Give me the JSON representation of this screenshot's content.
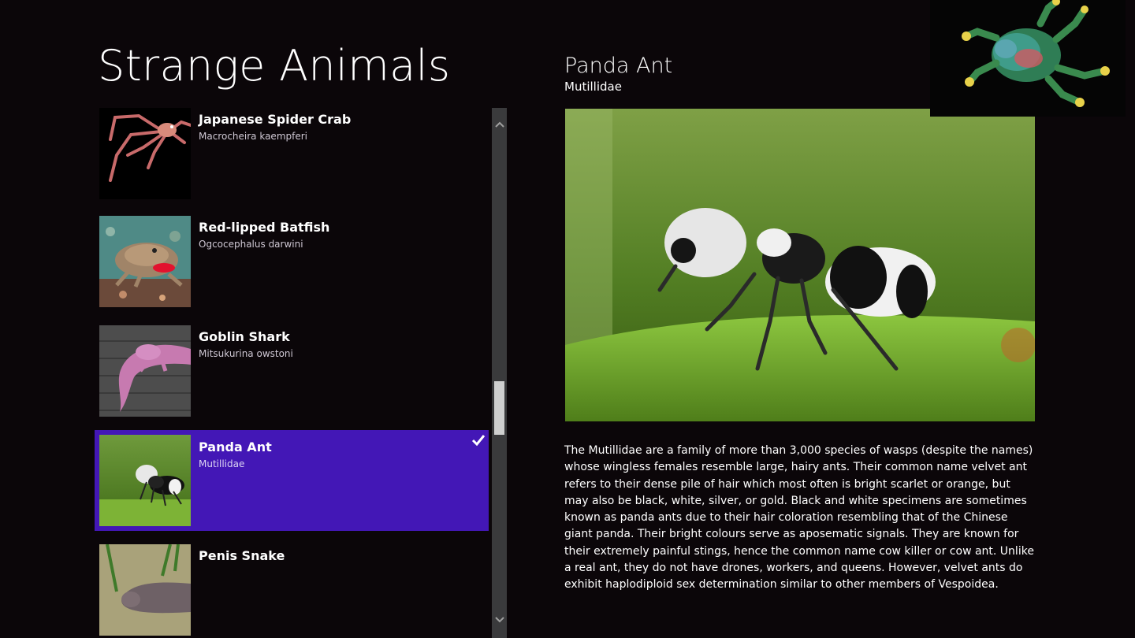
{
  "app": {
    "title": "Strange Animals"
  },
  "list": {
    "items": [
      {
        "name": "Japanese Spider Crab",
        "scientific": "Macrocheira kaempferi",
        "thumb_icon": "spider-crab-photo"
      },
      {
        "name": "Red-lipped Batfish",
        "scientific": "Ogcocephalus darwini",
        "thumb_icon": "batfish-photo"
      },
      {
        "name": "Goblin Shark",
        "scientific": "Mitsukurina owstoni",
        "thumb_icon": "goblin-shark-photo"
      },
      {
        "name": "Panda Ant",
        "scientific": "Mutillidae",
        "thumb_icon": "panda-ant-photo",
        "selected": true
      },
      {
        "name": "Penis Snake",
        "scientific": "",
        "thumb_icon": "penis-snake-photo"
      }
    ],
    "scroll_fraction": 0.52
  },
  "detail": {
    "title": "Panda Ant",
    "subtitle": "Mutillidae",
    "image_icon": "panda-ant-photo",
    "description": "The Mutillidae are a family of more than 3,000 species of wasps (despite the names) whose wingless females resemble large, hairy ants. Their common name velvet ant refers to their dense pile of hair which most often is bright scarlet or orange, but may also be black, white, silver, or gold. Black and white specimens are sometimes known as panda ants due to their hair coloration resembling that of the Chinese giant panda. Their bright colours serve as aposematic signals. They are known for their extremely painful stings, hence the common name cow killer or cow ant. Unlike a real ant, they do not have drones, workers, and queens. However, velvet ants do exhibit haplodiploid sex determination similar to other members of Vespoidea."
  },
  "colors": {
    "background": "#0b0609",
    "selection": "#4317b6",
    "scrollbar": "#3a3a3c"
  }
}
